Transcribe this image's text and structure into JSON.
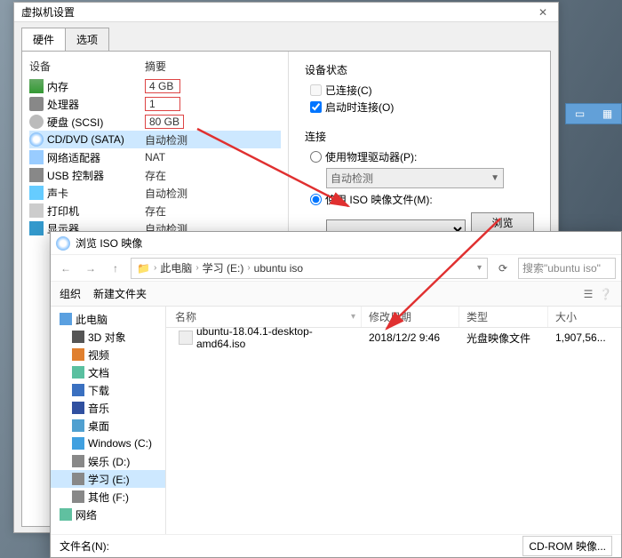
{
  "settings": {
    "title": "虚拟机设置",
    "tabs": [
      "硬件",
      "选项"
    ],
    "headers": {
      "device": "设备",
      "summary": "摘要"
    },
    "devices": [
      {
        "icon": "i-mem",
        "name": "内存",
        "value": "4 GB",
        "boxed": true
      },
      {
        "icon": "i-cpu",
        "name": "处理器",
        "value": "1",
        "boxed": true
      },
      {
        "icon": "i-hdd",
        "name": "硬盘 (SCSI)",
        "value": "80 GB",
        "boxed": true
      },
      {
        "icon": "i-cd",
        "name": "CD/DVD (SATA)",
        "value": "自动检测",
        "boxed": false,
        "selected": true
      },
      {
        "icon": "i-net",
        "name": "网络适配器",
        "value": "NAT",
        "boxed": false
      },
      {
        "icon": "i-usb",
        "name": "USB 控制器",
        "value": "存在",
        "boxed": false
      },
      {
        "icon": "i-snd",
        "name": "声卡",
        "value": "自动检测",
        "boxed": false
      },
      {
        "icon": "i-prn",
        "name": "打印机",
        "value": "存在",
        "boxed": false
      },
      {
        "icon": "i-mon",
        "name": "显示器",
        "value": "自动检测",
        "boxed": false
      }
    ],
    "status_group": "设备状态",
    "connected": "已连接(C)",
    "connect_on": "启动时连接(O)",
    "conn_group": "连接",
    "use_physical": "使用物理驱动器(P):",
    "auto_detect": "自动检测",
    "use_iso": "使用 ISO 映像文件(M):",
    "browse": "浏览(B)..."
  },
  "open": {
    "title": "浏览 ISO 映像",
    "crumbs": [
      "此电脑",
      "学习 (E:)",
      "ubuntu iso"
    ],
    "search_hint": "搜索\"ubuntu iso\"",
    "organize": "组织",
    "new_folder": "新建文件夹",
    "col": {
      "name": "名称",
      "date": "修改日期",
      "type": "类型",
      "size": "大小"
    },
    "file": {
      "name": "ubuntu-18.04.1-desktop-amd64.iso",
      "date": "2018/12/2 9:46",
      "type": "光盘映像文件",
      "size": "1,907,56..."
    },
    "tree": [
      {
        "cls": "t-pc",
        "label": "此电脑",
        "child": false,
        "sel": false
      },
      {
        "cls": "t-3d",
        "label": "3D 对象",
        "child": true
      },
      {
        "cls": "t-vid",
        "label": "视频",
        "child": true
      },
      {
        "cls": "t-doc",
        "label": "文档",
        "child": true
      },
      {
        "cls": "t-dl",
        "label": "下载",
        "child": true
      },
      {
        "cls": "t-mus",
        "label": "音乐",
        "child": true
      },
      {
        "cls": "t-desk",
        "label": "桌面",
        "child": true
      },
      {
        "cls": "t-win",
        "label": "Windows (C:)",
        "child": true
      },
      {
        "cls": "t-drv",
        "label": "娱乐 (D:)",
        "child": true
      },
      {
        "cls": "t-drv",
        "label": "学习 (E:)",
        "child": true,
        "sel": true
      },
      {
        "cls": "t-drv",
        "label": "其他 (F:)",
        "child": true
      },
      {
        "cls": "t-net2",
        "label": "网络",
        "child": false
      }
    ],
    "filename_label": "文件名(N):",
    "filter": "CD-ROM 映像..."
  }
}
